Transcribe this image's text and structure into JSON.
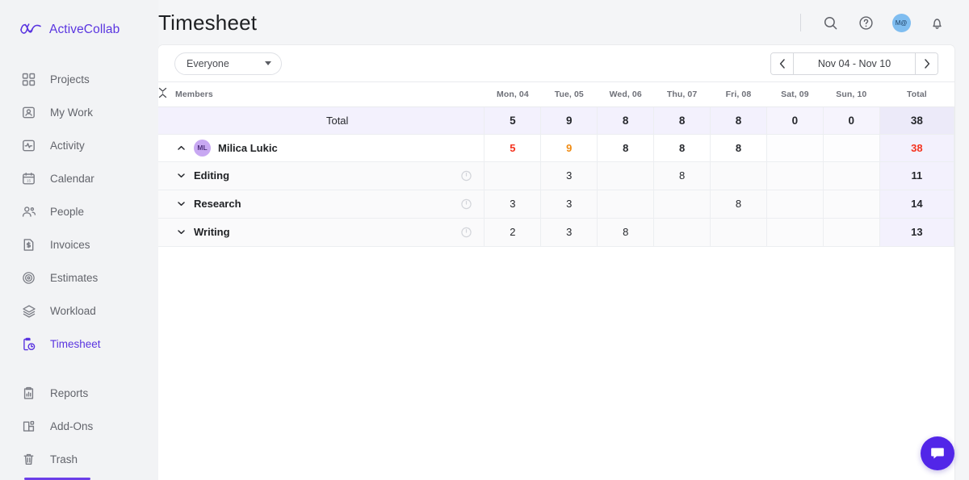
{
  "brand": {
    "name": "ActiveCollab",
    "logo_icon": "activecollab-logo-icon",
    "accent": "#5a35e0"
  },
  "sidebar": {
    "items": [
      {
        "label": "Projects",
        "icon": "grid-icon",
        "active": false
      },
      {
        "label": "My Work",
        "icon": "user-card-icon",
        "active": false
      },
      {
        "label": "Activity",
        "icon": "pulse-icon",
        "active": false
      },
      {
        "label": "Calendar",
        "icon": "calendar-icon",
        "active": false
      },
      {
        "label": "People",
        "icon": "people-icon",
        "active": false
      },
      {
        "label": "Invoices",
        "icon": "invoice-icon",
        "active": false
      },
      {
        "label": "Estimates",
        "icon": "target-icon",
        "active": false
      },
      {
        "label": "Workload",
        "icon": "layers-icon",
        "active": false
      },
      {
        "label": "Timesheet",
        "icon": "timesheet-icon",
        "active": true
      }
    ],
    "items_bottom": [
      {
        "label": "Reports",
        "icon": "reports-clipboard-icon",
        "active": false
      },
      {
        "label": "Add-Ons",
        "icon": "addons-icon",
        "active": false
      },
      {
        "label": "Trash",
        "icon": "trash-icon",
        "active": false
      }
    ]
  },
  "header": {
    "title": "Timesheet",
    "search_icon": "search-icon",
    "help_icon": "help-circle-icon",
    "bell_icon": "bell-icon",
    "avatar_initials": "M@",
    "avatar_color": "#7fbdf0"
  },
  "toolbar": {
    "filter_value": "Everyone",
    "filter_placeholder": "Everyone",
    "date_range": "Nov 04 - Nov 10",
    "prev_label": "‹",
    "next_label": "›"
  },
  "table": {
    "members_header": "Members",
    "collapse_icon": "collapse-expand-icon",
    "total_header": "Total",
    "day_headers": [
      "Mon, 04",
      "Tue, 05",
      "Wed, 06",
      "Thu, 07",
      "Fri, 08",
      "Sat, 09",
      "Sun, 10"
    ],
    "weekend_flags": [
      false,
      false,
      false,
      false,
      false,
      true,
      true
    ],
    "rows": [
      {
        "type": "total",
        "label": "Total",
        "values": [
          "5",
          "9",
          "8",
          "8",
          "8",
          "0",
          "0"
        ],
        "value_colors": [
          "",
          "",
          "",
          "",
          "",
          "",
          ""
        ],
        "total": "38",
        "total_color": ""
      },
      {
        "type": "member",
        "label": "Milica Lukic",
        "initials": "ML",
        "chevron": "chevron-up-icon",
        "values": [
          "5",
          "9",
          "8",
          "8",
          "8",
          "",
          ""
        ],
        "value_colors": [
          "#f4331f",
          "#f08b12",
          "",
          "",
          "",
          "",
          ""
        ],
        "total": "38",
        "total_color": "#f4331f"
      },
      {
        "type": "task",
        "label": "Editing",
        "chevron": "chevron-down-icon",
        "timer_icon": "stopwatch-icon",
        "values": [
          "",
          "3",
          "",
          "8",
          "",
          "",
          ""
        ],
        "value_colors": [
          "",
          "",
          "",
          "",
          "",
          "",
          ""
        ],
        "total": "11",
        "total_color": ""
      },
      {
        "type": "task",
        "label": "Research",
        "chevron": "chevron-down-icon",
        "timer_icon": "stopwatch-icon",
        "values": [
          "3",
          "3",
          "",
          "",
          "8",
          "",
          ""
        ],
        "value_colors": [
          "",
          "",
          "",
          "",
          "",
          "",
          ""
        ],
        "total": "14",
        "total_color": ""
      },
      {
        "type": "task",
        "label": "Writing",
        "chevron": "chevron-down-icon",
        "timer_icon": "stopwatch-icon",
        "values": [
          "2",
          "3",
          "8",
          "",
          "",
          "",
          ""
        ],
        "value_colors": [
          "",
          "",
          "",
          "",
          "",
          "",
          ""
        ],
        "total": "13",
        "total_color": ""
      }
    ]
  },
  "chat": {
    "icon": "chat-bubble-icon",
    "color": "#5226e8"
  }
}
